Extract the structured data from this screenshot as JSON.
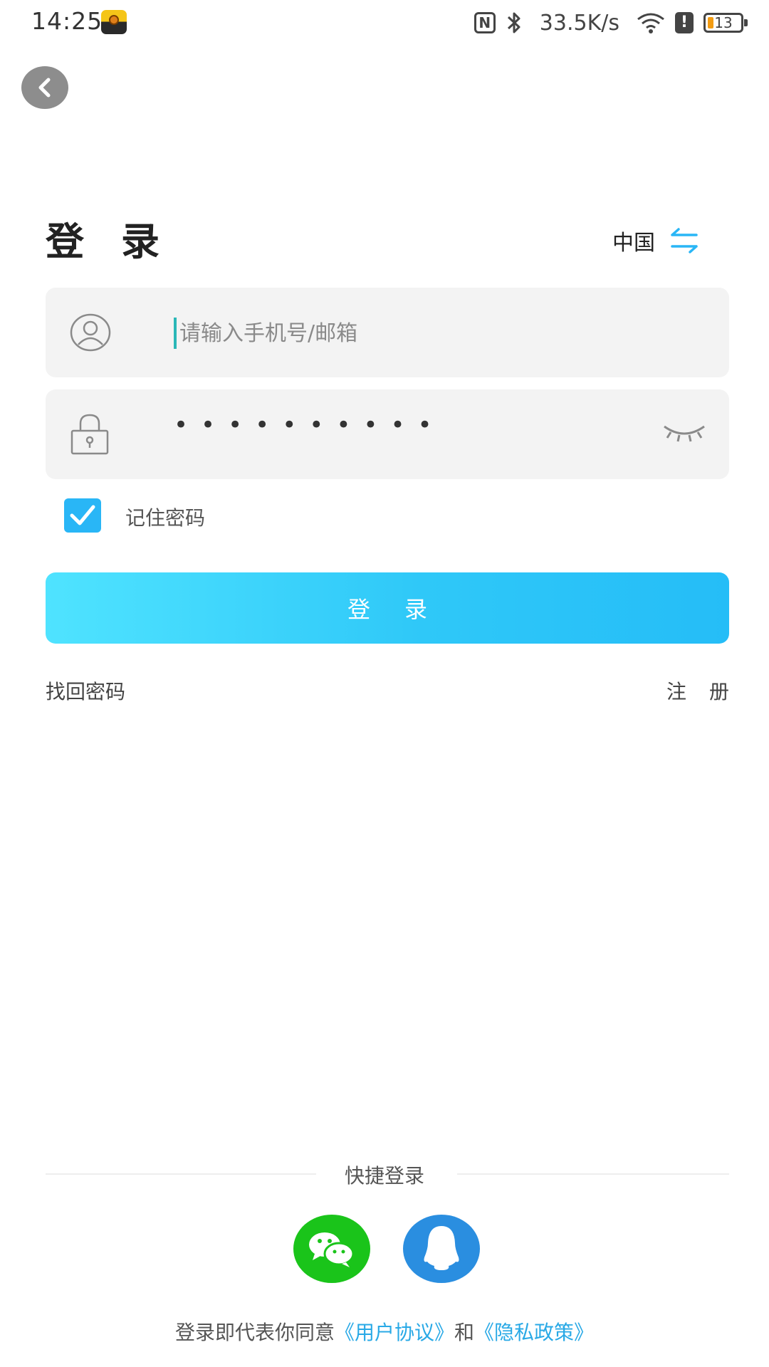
{
  "status_bar": {
    "time": "14:25",
    "net_speed": "33.5K/s",
    "battery_level": "13",
    "icons": [
      "app-notification-icon",
      "nfc-icon",
      "bluetooth-icon",
      "wifi-icon",
      "alert-icon",
      "battery-icon"
    ]
  },
  "header": {
    "title": "登录",
    "region": "中国",
    "region_icon": "swap-arrows-icon"
  },
  "form": {
    "phone_placeholder": "请输入手机号/邮箱",
    "phone_value": "",
    "password_value": "••••••••••",
    "remember_checked": true,
    "remember_label": "记住密码",
    "login_label": "登录",
    "forgot_label": "找回密码",
    "register_label": "注册"
  },
  "quick_login": {
    "label": "快捷登录",
    "options": [
      "wechat-icon",
      "qq-icon"
    ]
  },
  "agreement": {
    "prefix": "登录即代表你同意",
    "user_agreement": "《用户协议》",
    "conjunction": "和",
    "privacy_policy": "《隐私政策》"
  },
  "colors": {
    "accent": "#29b6f6",
    "login_gradient_start": "#4fe3ff",
    "login_gradient_end": "#25bdf7",
    "wechat": "#1ac41a",
    "qq": "#2a8ee0",
    "input_bg": "#f3f3f3",
    "link": "#29a9e6"
  }
}
